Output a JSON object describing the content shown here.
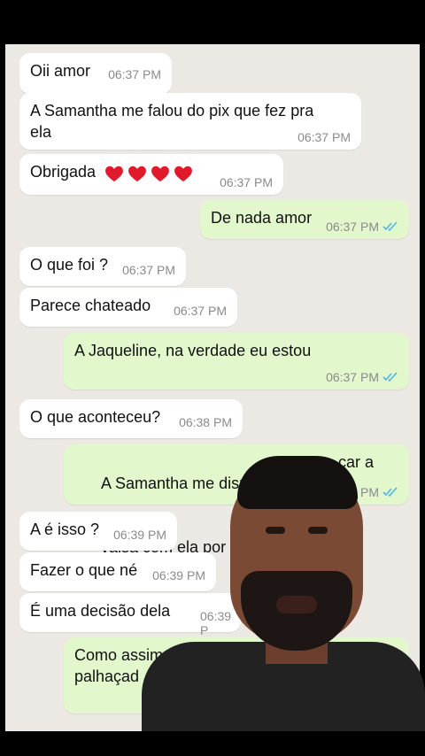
{
  "messages": [
    {
      "dir": "in",
      "text": "Oii amor",
      "time": "06:37 PM"
    },
    {
      "dir": "in",
      "text": "A Samantha me falou do pix que fez pra ela",
      "time": "06:37 PM"
    },
    {
      "dir": "in",
      "text": "Obrigada",
      "hearts": 4,
      "time": "06:37 PM"
    },
    {
      "dir": "out",
      "text": "De nada amor",
      "time": "06:37 PM",
      "status": "read"
    },
    {
      "dir": "in",
      "text": "O que foi ?",
      "time": "06:37 PM"
    },
    {
      "dir": "in",
      "text": "Parece chateado",
      "time": "06:37 PM"
    },
    {
      "dir": "out",
      "text": "A Jaqueline, na verdade eu estou",
      "time": "06:37 PM",
      "status": "read"
    },
    {
      "dir": "in",
      "text": "O que aconteceu?",
      "time": "06:38 PM"
    },
    {
      "dir": "out",
      "text_line1": "A Samantha me dispenso",
      "text_line1_end": "car a",
      "text_line2": "valsa com ela por causa",
      "time_visible": "PM",
      "status": "read"
    },
    {
      "dir": "in",
      "text": "A é isso ?",
      "time": "06:39 PM"
    },
    {
      "dir": "in",
      "text": "Fazer o que né",
      "time": "06:39 PM"
    },
    {
      "dir": "in",
      "text": "É uma decisão dela",
      "time_visible": "06:39 P"
    },
    {
      "dir": "out",
      "text_line1": "Como assim ? Vo",
      "text_line2": "palhaçad"
    }
  ],
  "colors": {
    "chat_bg": "#ece9e4",
    "incoming": "#ffffff",
    "outgoing": "#e2f7cb",
    "read_ticks": "#4fb6ec",
    "heart": "#e0192b"
  }
}
